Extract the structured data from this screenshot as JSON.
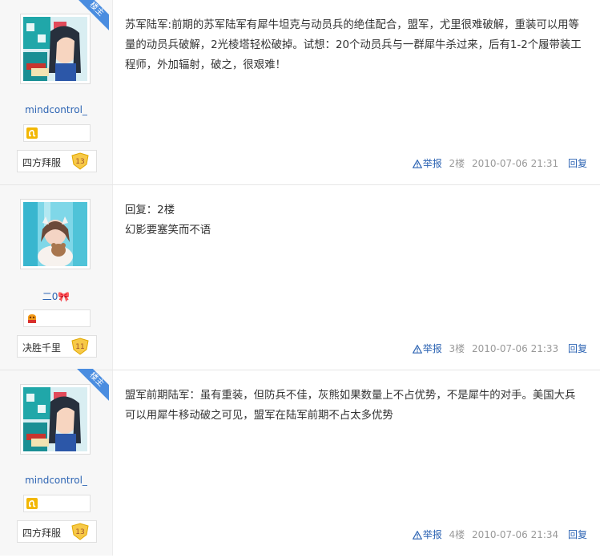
{
  "posts": [
    {
      "floor": "2楼",
      "is_op": true,
      "op_label": "楼主",
      "username": "mindcontrol_",
      "badge_icon": "leo-zodiac-icon",
      "level_name": "四方拜服",
      "level_num": "13",
      "content": [
        "苏军陆军:前期的苏军陆军有犀牛坦克与动员兵的绝佳配合，盟军，尤里很难破解，重装可以用等量的动员兵破解，2光棱塔轻松破掉。试想：20个动员兵与一群犀牛杀过来，后有1-2个履带装工程师，外加辐射，破之，很艰难！"
      ],
      "report": "举报",
      "time": "2010-07-06 21:31",
      "reply": "回复"
    },
    {
      "floor": "3楼",
      "is_op": false,
      "username": "二0🎀",
      "badge_icon": "boxing-glove-icon",
      "level_name": "决胜千里",
      "level_num": "11",
      "content": [
        "回复：2楼",
        "幻影要塞笑而不语"
      ],
      "report": "举报",
      "time": "2010-07-06 21:33",
      "reply": "回复"
    },
    {
      "floor": "4楼",
      "is_op": true,
      "op_label": "楼主",
      "username": "mindcontrol_",
      "badge_icon": "leo-zodiac-icon",
      "level_name": "四方拜服",
      "level_num": "13",
      "content": [
        "盟军前期陆军：虽有重装，但防兵不佳，灰熊如果数量上不占优势，不是犀牛的对手。美国大兵可以用犀牛移动破之可见，盟军在陆军前期不占太多优势"
      ],
      "report": "举报",
      "time": "2010-07-06 21:34",
      "reply": "回复"
    }
  ],
  "colors": {
    "link": "#2d64b3",
    "ribbon": "#4a8de0",
    "level_shield": "#f7c948"
  }
}
